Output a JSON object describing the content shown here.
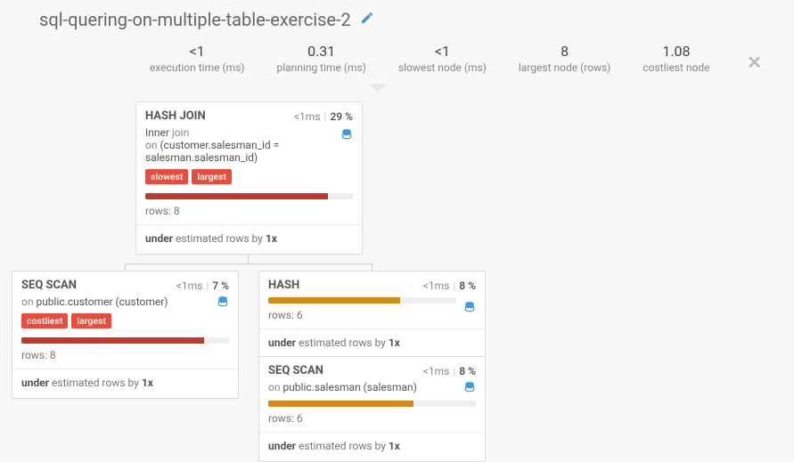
{
  "title": "sql-quering-on-multiple-table-exercise-2",
  "stats": {
    "exec_time_val": "<1",
    "exec_time_lbl": "execution time (ms)",
    "plan_time_val": "0.31",
    "plan_time_lbl": "planning time (ms)",
    "slowest_val": "<1",
    "slowest_lbl": "slowest node (ms)",
    "largest_val": "8",
    "largest_lbl": "largest node (rows)",
    "costliest_val": "1.08",
    "costliest_lbl": "costliest node"
  },
  "nodes": {
    "hashjoin": {
      "name": "HASH JOIN",
      "time": "<1ms",
      "pct": "29 %",
      "sub_dark": "Inner",
      "sub_light1": " join",
      "sub_line2a": "on ",
      "sub_line2b": "(customer.salesman_id = salesman.salesman_id)",
      "tag1": "slowest",
      "tag2": "largest",
      "bar_width": "88%",
      "rows": "rows: 8",
      "est_b1": "under",
      "est_mid": " estimated rows by ",
      "est_b2": "1x"
    },
    "seqcust": {
      "name": "SEQ SCAN",
      "time": "<1ms",
      "pct": "7 %",
      "sub_on": "on ",
      "sub_tbl": "public.customer (customer)",
      "tag1": "costliest",
      "tag2": "largest",
      "bar_width": "88%",
      "rows": "rows: 8",
      "est_b1": "under",
      "est_mid": " estimated rows by ",
      "est_b2": "1x"
    },
    "hash": {
      "name": "HASH",
      "time": "<1ms",
      "pct": "8 %",
      "bar_width": "70%",
      "rows": "rows: 6",
      "est_b1": "under",
      "est_mid": " estimated rows by ",
      "est_b2": "1x"
    },
    "seqsales": {
      "name": "SEQ SCAN",
      "time": "<1ms",
      "pct": "8 %",
      "sub_on": "on ",
      "sub_tbl": "public.salesman (salesman)",
      "bar_width": "70%",
      "rows": "rows: 6",
      "est_b1": "under",
      "est_mid": " estimated rows by ",
      "est_b2": "1x"
    }
  }
}
